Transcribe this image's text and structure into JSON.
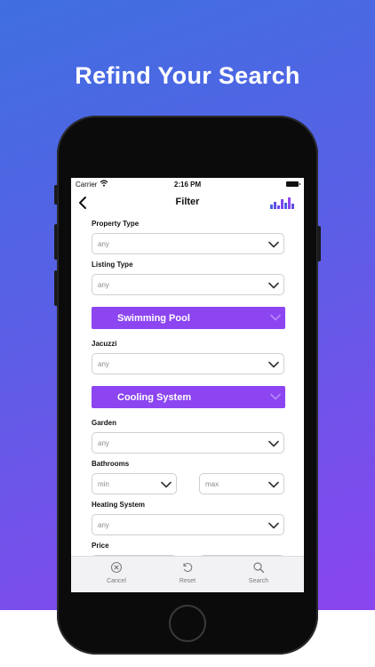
{
  "headline": "Refind Your Search",
  "status_bar": {
    "carrier": "Carrier",
    "time": "2:16 PM"
  },
  "nav": {
    "title": "Filter",
    "back_icon": "chevron-left-icon",
    "logo": "bar-chart-logo"
  },
  "form": {
    "property_type": {
      "label": "Property Type",
      "value": "any"
    },
    "listing_type": {
      "label": "Listing Type",
      "value": "any"
    },
    "swimming_pool": {
      "label": "Swimming Pool"
    },
    "jacuzzi": {
      "label": "Jacuzzi",
      "value": "any"
    },
    "cooling_system": {
      "label": "Cooling System"
    },
    "garden": {
      "label": "Garden",
      "value": "any"
    },
    "bathrooms": {
      "label": "Bathrooms",
      "min": "min",
      "max": "max"
    },
    "heating_system": {
      "label": "Heating System",
      "value": "any"
    },
    "price": {
      "label": "Price"
    }
  },
  "tabbar": {
    "cancel": "Cancel",
    "reset": "Reset",
    "search": "Search"
  },
  "colors": {
    "accent": "#8c45f0",
    "gradient_start": "#3f6fe0",
    "gradient_end": "#8a45ee"
  }
}
